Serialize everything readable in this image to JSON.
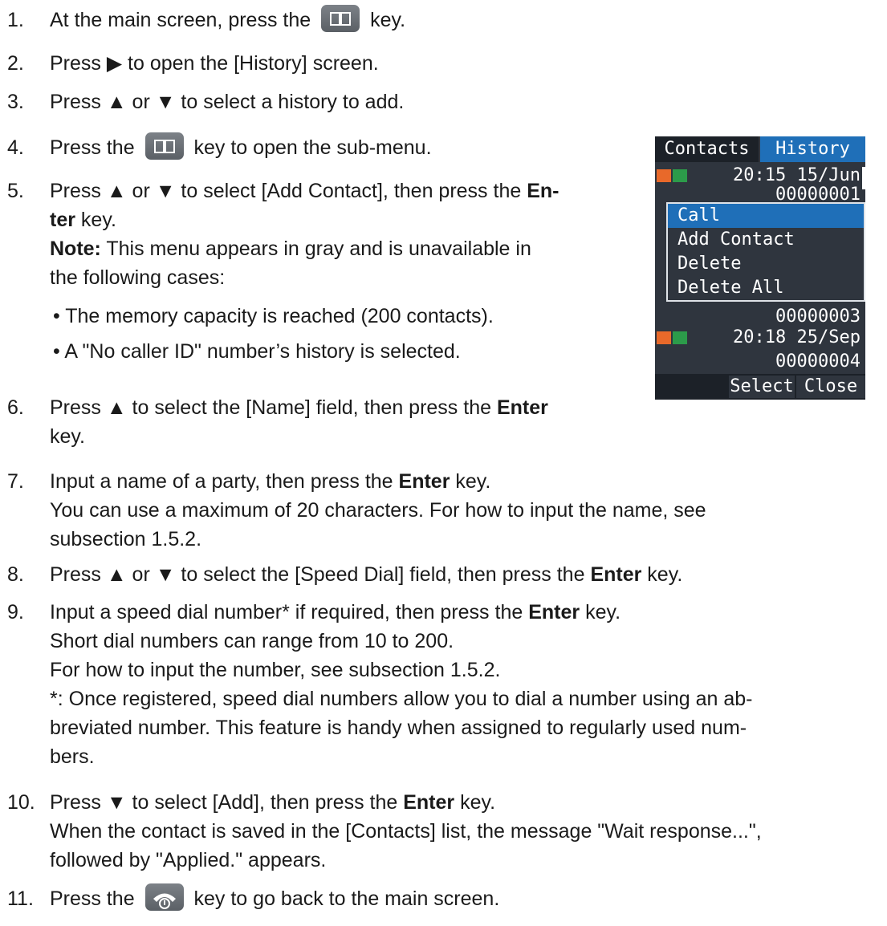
{
  "steps": [
    {
      "num": "1.",
      "pre": "At the main screen, press the",
      "post": "key."
    },
    {
      "num": "2.",
      "text": "Press ▶ to open the [History] screen."
    },
    {
      "num": "3.",
      "text": "Press ▲ or ▼ to select a history to add."
    },
    {
      "num": "4.",
      "pre": "Press the",
      "post": "key to open the sub-menu."
    },
    {
      "num": "5.",
      "l1a": "Press ▲ or ▼ to select [Add Contact], then press the ",
      "l1b": "En-",
      "l2a": "ter",
      "l2b": " key.",
      "note_label": "Note:",
      "note_l1": " This menu appears in gray and is unavailable in",
      "note_l2": "the following cases:",
      "bullets": [
        "• The memory capacity is reached (200 contacts).",
        "• A \"No caller ID\" number’s history is selected."
      ]
    },
    {
      "num": "6.",
      "l1a": "Press ▲ to select the [Name] field, then press the ",
      "l1b": "Enter",
      "l2": "key."
    },
    {
      "num": "7.",
      "l1a": "Input a name of a party, then press the ",
      "l1b": "Enter",
      "l1c": " key.",
      "l2": "You can use a maximum of 20 characters. For how to input the name, see",
      "l3": "subsection 1.5.2."
    },
    {
      "num": "8.",
      "l1a": "Press ▲ or ▼ to select the [Speed Dial] field, then press the ",
      "l1b": "Enter",
      "l1c": " key."
    },
    {
      "num": "9.",
      "l1a": "Input a speed dial number* if required, then press the ",
      "l1b": "Enter",
      "l1c": " key.",
      "l2": "Short dial numbers can range from 10 to 200.",
      "l3": "For how to input the number, see subsection 1.5.2.",
      "l4": "*: Once registered, speed dial numbers allow you to dial a number using an ab-",
      "l5": "breviated number. This feature is handy when assigned to regularly used num-",
      "l6": "bers."
    },
    {
      "num": "10.",
      "l1a": "Press ▼ to select [Add], then press the ",
      "l1b": "Enter",
      "l1c": " key.",
      "l2": "When the contact is saved in the [Contacts] list, the message \"Wait response...\",",
      "l3": "followed by \"Applied.\" appears."
    },
    {
      "num": "11.",
      "pre": "Press the",
      "post": "key to go back to the main screen."
    }
  ],
  "screen": {
    "tabs": [
      "Contacts",
      "History"
    ],
    "rows": [
      {
        "value": "20:15 15/Jun"
      },
      {
        "value": "00000001"
      },
      {
        "value": "00000003"
      },
      {
        "value": "20:18 25/Sep"
      },
      {
        "value": "00000004"
      }
    ],
    "menu": [
      "Call",
      "Add Contact",
      "Delete",
      "Delete All"
    ],
    "softkeys": [
      "Select",
      "Close"
    ],
    "colors": {
      "tab_active": "#1f6fb8",
      "bg": "#2f353e",
      "icon_out": "#e8692a",
      "icon_call": "#2c9b4a"
    }
  },
  "icons": {
    "phonebook_key": "book-icon",
    "hangup_key": "on-hook-icon"
  }
}
